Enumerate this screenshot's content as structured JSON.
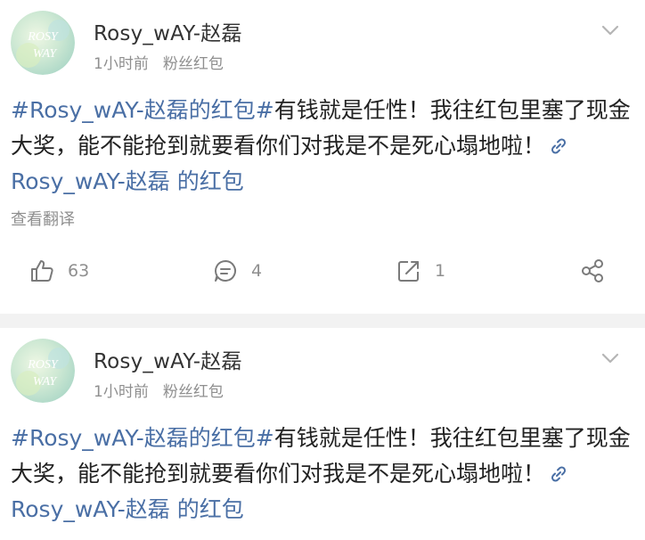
{
  "posts": [
    {
      "username": "Rosy_wAY-赵磊",
      "time": "1小时前",
      "source": "粉丝红包",
      "avatar_text_top": "ROSY",
      "avatar_text_bottom": "WAY",
      "content": {
        "topic": "#Rosy_wAY-赵磊的红包#",
        "text": "有钱就是任性！我往红包里塞了现金大奖，能不能抢到就要看你们对我是不是死心塌地啦！",
        "link_text": "Rosy_wAY-赵磊 的红包"
      },
      "translate_label": "查看翻译",
      "likes": "63",
      "comments": "4",
      "reposts": "1"
    },
    {
      "username": "Rosy_wAY-赵磊",
      "time": "1小时前",
      "source": "粉丝红包",
      "avatar_text_top": "ROSY",
      "avatar_text_bottom": "WAY",
      "content": {
        "topic": "#Rosy_wAY-赵磊的红包#",
        "text": "有钱就是任性！我往红包里塞了现金大奖，能不能抢到就要看你们对我是不是死心塌地啦！",
        "link_text": "Rosy_wAY-赵磊 的红包"
      }
    }
  ],
  "icons": {
    "like": "thumbs-up-icon",
    "comment": "comment-icon",
    "repost": "repost-icon",
    "share": "share-icon",
    "more": "chevron-down-icon",
    "link": "link-icon"
  },
  "colors": {
    "link": "#4a6fa5",
    "meta_text": "#8f8f8f",
    "body_text": "#222222",
    "separator": "#f2f2f2"
  }
}
